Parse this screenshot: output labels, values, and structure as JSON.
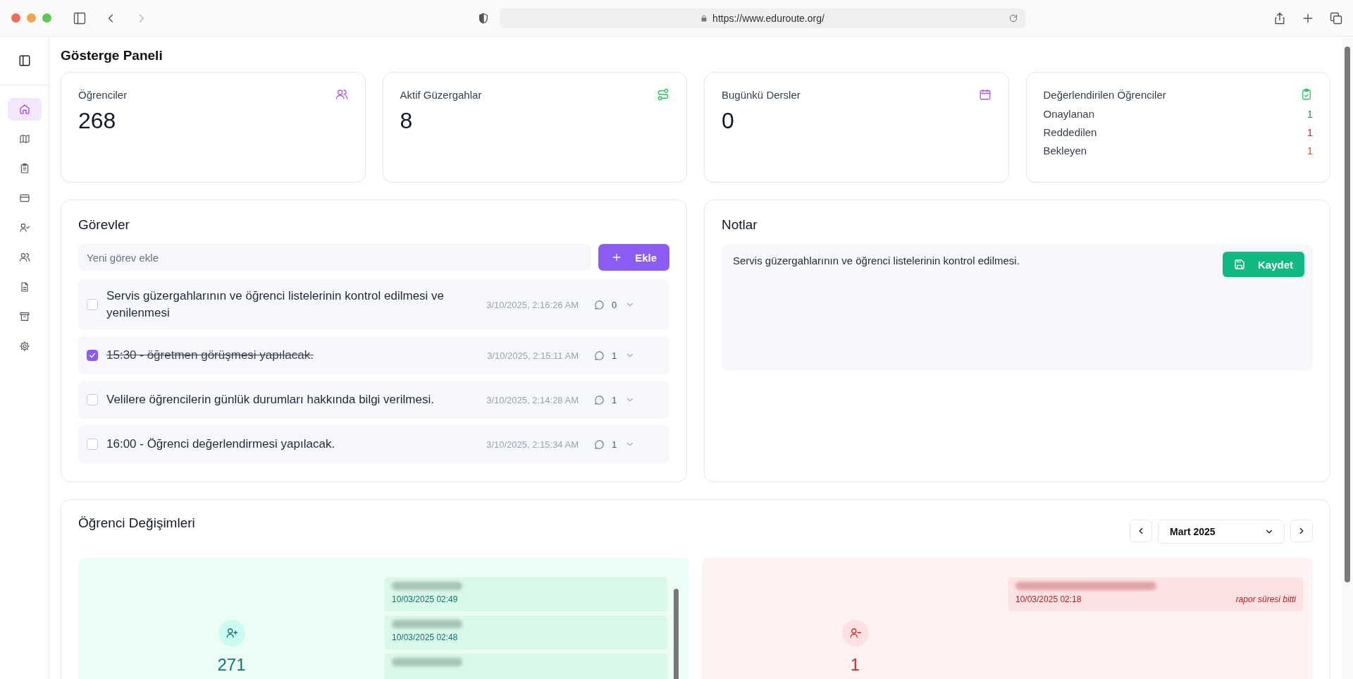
{
  "browser": {
    "url": "https://www.eduroute.org/"
  },
  "sidebar": {
    "items": [
      {
        "kind": "home",
        "selected": true
      },
      {
        "kind": "map",
        "selected": false
      },
      {
        "kind": "clipboard",
        "selected": false
      },
      {
        "kind": "card",
        "selected": false
      },
      {
        "kind": "user-check",
        "selected": false
      },
      {
        "kind": "users",
        "selected": false
      },
      {
        "kind": "file",
        "selected": false
      },
      {
        "kind": "archive",
        "selected": false
      },
      {
        "kind": "settings",
        "selected": false
      }
    ]
  },
  "page_title": "Gösterge Paneli",
  "stats": [
    {
      "kind": "count",
      "label": "Öğrenciler",
      "value": "268"
    },
    {
      "kind": "count",
      "label": "Aktif Güzergahlar",
      "value": "8"
    },
    {
      "kind": "count",
      "label": "Bugünkü Dersler",
      "value": "0"
    },
    {
      "kind": "breakdown",
      "label": "Değerlendirilen Öğrenciler",
      "rows": [
        {
          "label": "Onaylanan",
          "value": "1",
          "color": "#16a34a"
        },
        {
          "label": "Reddedilen",
          "value": "1",
          "color": "#dc2626"
        },
        {
          "label": "Bekleyen",
          "value": "1",
          "color": "#ea580c"
        }
      ]
    }
  ],
  "tasks": {
    "title": "Görevler",
    "input": {
      "placeholder": "Yeni görev ekle"
    },
    "add_button": "Ekle",
    "items": [
      {
        "text": "Servis güzergahlarının ve öğrenci listelerinin kontrol edilmesi ve yenilenmesi",
        "time": "3/10/2025, 2:16:26 AM",
        "comments": "0",
        "checked": false
      },
      {
        "text": "15:30 - öğretmen görüşmesi yapılacak.",
        "time": "3/10/2025, 2:15:11 AM",
        "comments": "1",
        "checked": true
      },
      {
        "text": "Velilere öğrencilerin günlük durumları hakkında bilgi verilmesi.",
        "time": "3/10/2025, 2:14:28 AM",
        "comments": "1",
        "checked": false
      },
      {
        "text": "16:00 - Öğrenci değerlendirmesi yapılacak.",
        "time": "3/10/2025, 2:15:34 AM",
        "comments": "1",
        "checked": false
      }
    ]
  },
  "notes": {
    "title": "Notlar",
    "value": "Servis güzergahlarının ve öğrenci listelerinin kontrol edilmesi.",
    "save_button": "Kaydet"
  },
  "changes": {
    "title": "Öğrenci Değişimleri",
    "month": "Mart 2025",
    "added": {
      "count": "271",
      "entries": [
        {
          "date": "10/03/2025 02:49"
        },
        {
          "date": "10/03/2025 02:48"
        }
      ]
    },
    "removed": {
      "count": "1",
      "entries": [
        {
          "date": "10/03/2025 02:18",
          "reason": "rapor süresi bitti"
        }
      ]
    }
  }
}
